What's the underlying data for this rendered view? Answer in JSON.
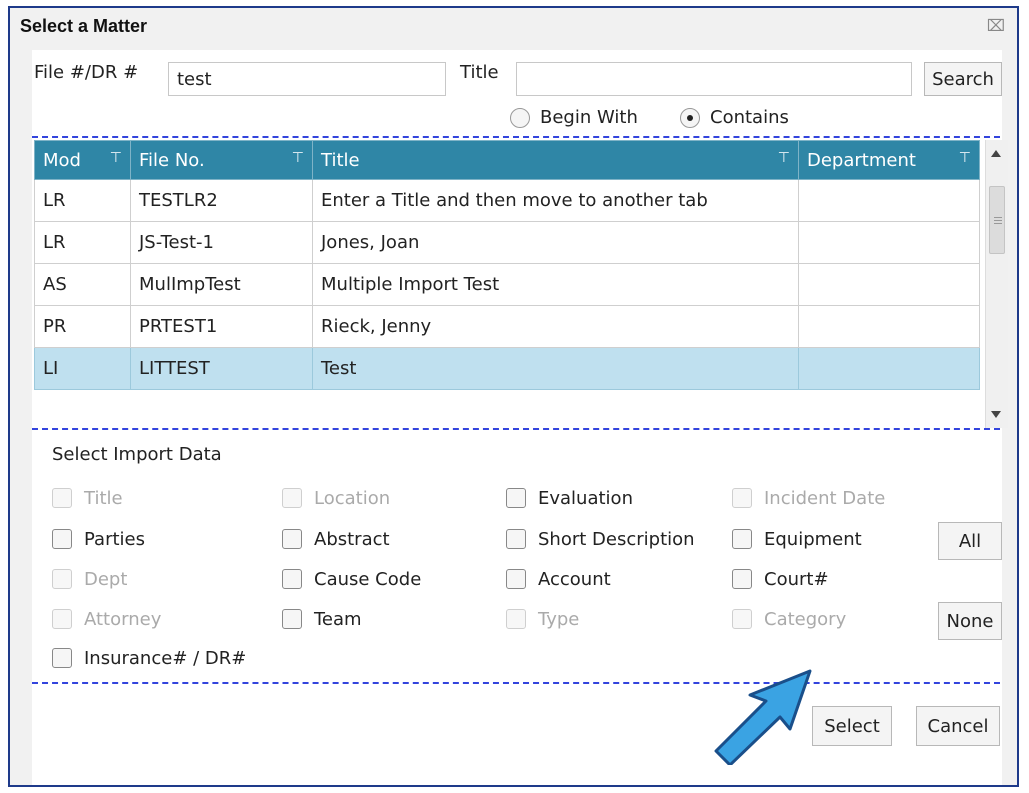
{
  "window": {
    "title": "Select a Matter",
    "close_icon": "close-icon"
  },
  "search": {
    "file_label": "File #/DR #",
    "file_value": "test",
    "title_label": "Title",
    "title_value": "",
    "search_button": "Search",
    "radio_begin": "Begin With",
    "radio_contains": "Contains",
    "selected_radio": "Contains"
  },
  "grid": {
    "columns": [
      "Mod",
      "File No.",
      "Title",
      "Department"
    ],
    "rows": [
      {
        "mod": "LR",
        "file": "TESTLR2",
        "title": "Enter a Title and then move to another tab",
        "dept": ""
      },
      {
        "mod": "LR",
        "file": "JS-Test-1",
        "title": "Jones, Joan",
        "dept": ""
      },
      {
        "mod": "AS",
        "file": "MulImpTest",
        "title": "Multiple Import Test",
        "dept": ""
      },
      {
        "mod": "PR",
        "file": "PRTEST1",
        "title": "Rieck, Jenny",
        "dept": ""
      },
      {
        "mod": "LI",
        "file": "LITTEST",
        "title": "Test",
        "dept": ""
      }
    ],
    "selected_row_index": 4,
    "header_color": "#2f86a6",
    "selected_color": "#bfe0ef"
  },
  "import": {
    "title": "Select Import Data",
    "options": [
      {
        "label": "Title",
        "enabled": false
      },
      {
        "label": "Location",
        "enabled": false
      },
      {
        "label": "Evaluation",
        "enabled": true
      },
      {
        "label": "Incident Date",
        "enabled": false
      },
      {
        "label": "Parties",
        "enabled": true
      },
      {
        "label": "Abstract",
        "enabled": true
      },
      {
        "label": "Short Description",
        "enabled": true
      },
      {
        "label": "Equipment",
        "enabled": true
      },
      {
        "label": "Dept",
        "enabled": false
      },
      {
        "label": "Cause Code",
        "enabled": true
      },
      {
        "label": "Account",
        "enabled": true
      },
      {
        "label": "Court#",
        "enabled": true
      },
      {
        "label": "Attorney",
        "enabled": false
      },
      {
        "label": "Team",
        "enabled": true
      },
      {
        "label": "Type",
        "enabled": false
      },
      {
        "label": "Category",
        "enabled": false
      },
      {
        "label": "Insurance# / DR#",
        "enabled": true
      }
    ],
    "all_button": "All",
    "none_button": "None"
  },
  "footer": {
    "select_button": "Select",
    "cancel_button": "Cancel",
    "pointer_color": "#3aa3e3"
  }
}
